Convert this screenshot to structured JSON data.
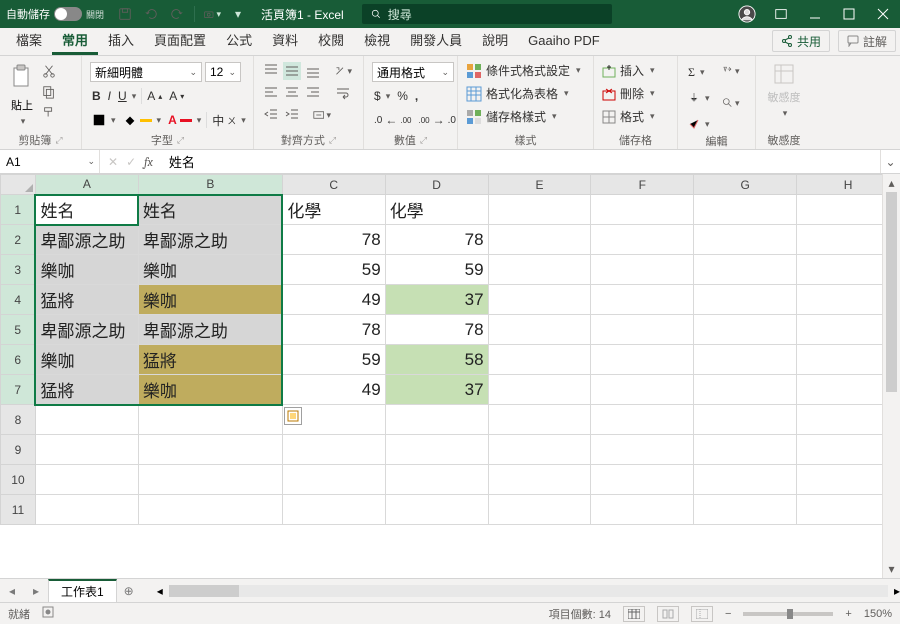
{
  "titlebar": {
    "autosave_label": "自動儲存",
    "toggle_state": "關閉",
    "doc_title": "活頁簿1 - Excel",
    "search_placeholder": "搜尋"
  },
  "tabs": {
    "items": [
      "檔案",
      "常用",
      "插入",
      "頁面配置",
      "公式",
      "資料",
      "校閱",
      "檢視",
      "開發人員",
      "說明",
      "Gaaiho PDF"
    ],
    "active_index": 1,
    "share": "共用",
    "comment": "註解"
  },
  "ribbon": {
    "clipboard": {
      "label": "剪貼簿",
      "paste": "貼上"
    },
    "font": {
      "label": "字型",
      "name": "新細明體",
      "size": "12"
    },
    "align": {
      "label": "對齊方式"
    },
    "number": {
      "label": "數值",
      "format": "通用格式"
    },
    "styles": {
      "label": "樣式",
      "cond": "條件式格式設定",
      "as_table": "格式化為表格",
      "cell_styles": "儲存格樣式"
    },
    "cells": {
      "label": "儲存格",
      "insert": "插入",
      "delete": "刪除",
      "format": "格式"
    },
    "editing": {
      "label": "編輯"
    },
    "sensitivity": {
      "label": "敏感度",
      "btn": "敏感度"
    }
  },
  "namebox": {
    "ref": "A1",
    "formula": "姓名"
  },
  "grid": {
    "columns": [
      "A",
      "B",
      "C",
      "D",
      "E",
      "F",
      "G",
      "H"
    ],
    "rows": [
      1,
      2,
      3,
      4,
      5,
      6,
      7,
      8,
      9,
      10,
      11
    ],
    "selected_cols": [
      0,
      1
    ],
    "selected_rows": [
      0,
      1,
      2,
      3,
      4,
      5,
      6
    ],
    "data": [
      [
        "姓名",
        "姓名",
        "化學",
        "化學",
        "",
        "",
        "",
        ""
      ],
      [
        "卑鄙源之助",
        "卑鄙源之助",
        "78",
        "78",
        "",
        "",
        "",
        ""
      ],
      [
        "樂咖",
        "樂咖",
        "59",
        "59",
        "",
        "",
        "",
        ""
      ],
      [
        "猛將",
        "樂咖",
        "49",
        "37",
        "",
        "",
        "",
        ""
      ],
      [
        "卑鄙源之助",
        "卑鄙源之助",
        "78",
        "78",
        "",
        "",
        "",
        ""
      ],
      [
        "樂咖",
        "猛將",
        "59",
        "58",
        "",
        "",
        "",
        ""
      ],
      [
        "猛將",
        "樂咖",
        "49",
        "37",
        "",
        "",
        "",
        ""
      ],
      [
        "",
        "",
        "",
        "",
        "",
        "",
        "",
        ""
      ],
      [
        "",
        "",
        "",
        "",
        "",
        "",
        "",
        ""
      ],
      [
        "",
        "",
        "",
        "",
        "",
        "",
        "",
        ""
      ],
      [
        "",
        "",
        "",
        "",
        "",
        "",
        "",
        ""
      ]
    ],
    "olive_cells": [
      [
        3,
        1
      ],
      [
        5,
        1
      ],
      [
        6,
        1
      ]
    ],
    "green_cells": [
      [
        3,
        3
      ],
      [
        5,
        3
      ],
      [
        6,
        3
      ]
    ]
  },
  "sheettab": {
    "name": "工作表1"
  },
  "status": {
    "ready": "就緒",
    "count_label": "項目個數:",
    "count": "14",
    "zoom": "150%"
  }
}
